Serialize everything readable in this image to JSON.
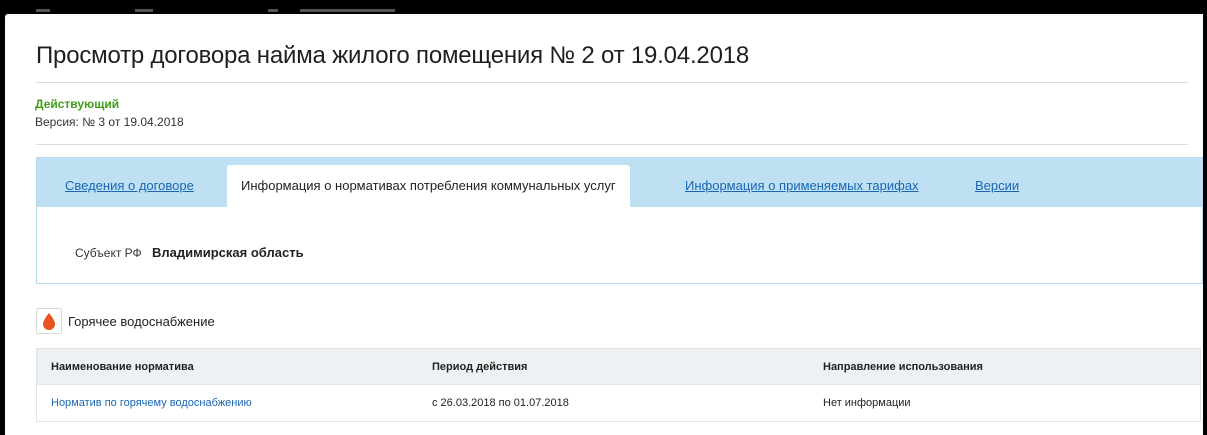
{
  "page": {
    "title": "Просмотр договора найма жилого помещения № 2 от 19.04.2018",
    "status": "Действующий",
    "version": "Версия: № 3 от 19.04.2018"
  },
  "tabs": [
    {
      "label": "Сведения о договоре",
      "active": false
    },
    {
      "label": "Информация о нормативах потребления коммунальных услуг",
      "active": true
    },
    {
      "label": "Информация о применяемых тарифах",
      "active": false
    },
    {
      "label": "Версии",
      "active": false
    }
  ],
  "subject": {
    "label": "Субъект РФ",
    "value": "Владимирская область"
  },
  "service": {
    "name": "Горячее водоснабжение",
    "icon": "drop-icon",
    "icon_color": "#e8531f"
  },
  "table": {
    "headers": [
      "Наименование норматива",
      "Период действия",
      "Направление использования"
    ],
    "rows": [
      [
        "Норматив по горячему водоснабжению",
        "с 26.03.2018 по 01.07.2018",
        "Нет информации"
      ]
    ]
  },
  "colors": {
    "accent_link": "#1a66b3",
    "status_green": "#3f9f1a",
    "tab_bar": "#bfe0f3"
  }
}
